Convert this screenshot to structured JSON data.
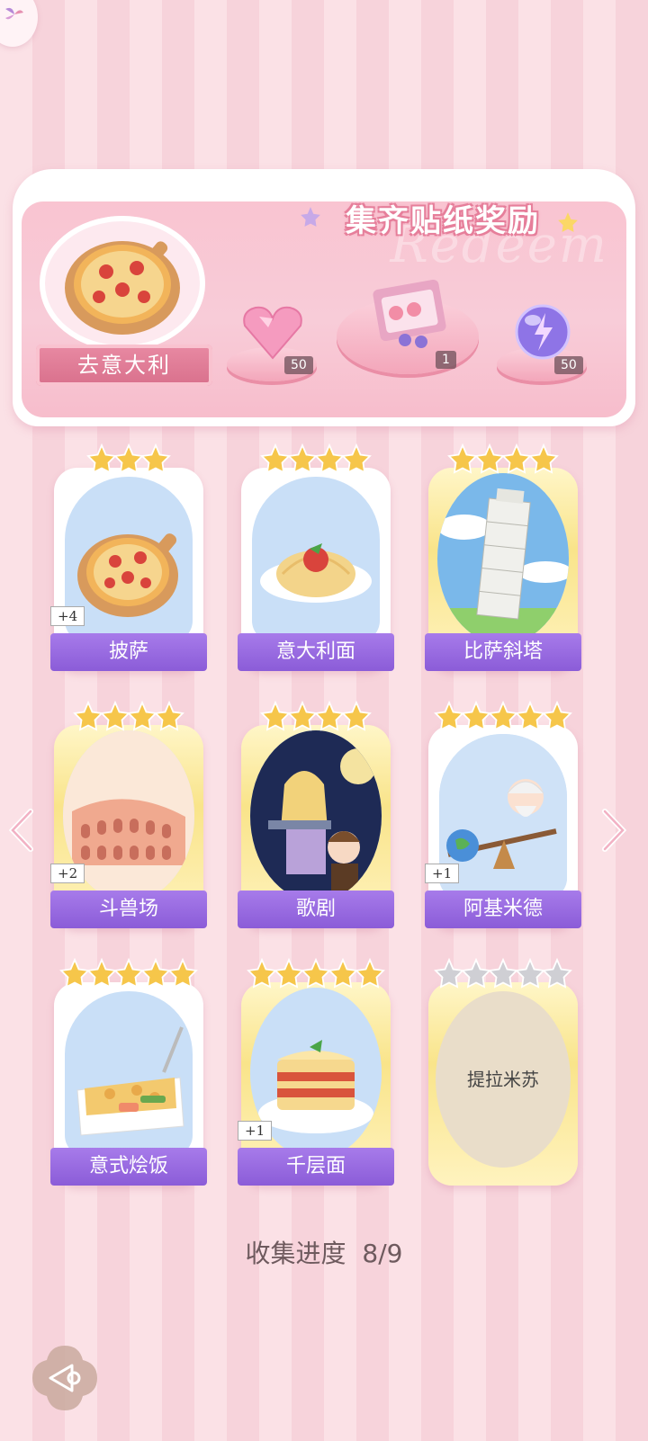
{
  "header": {
    "menu_icon": "fan-menu-icon"
  },
  "reward": {
    "title": "集齐贴纸奖励",
    "watermark": "Redeem",
    "region": "去意大利",
    "items": [
      {
        "icon": "pink-heart-gem-icon",
        "count": "50"
      },
      {
        "icon": "gift-box-icon",
        "count": "1"
      },
      {
        "icon": "purple-energy-orb-icon",
        "count": "50"
      }
    ]
  },
  "cards": [
    {
      "name": "披萨",
      "stars": 3,
      "max_stars": 3,
      "bonus": "+4",
      "gold": false,
      "collected": true
    },
    {
      "name": "意大利面",
      "stars": 4,
      "max_stars": 4,
      "bonus": "",
      "gold": false,
      "collected": true
    },
    {
      "name": "比萨斜塔",
      "stars": 4,
      "max_stars": 4,
      "bonus": "",
      "gold": true,
      "collected": true
    },
    {
      "name": "斗兽场",
      "stars": 4,
      "max_stars": 4,
      "bonus": "+2",
      "gold": true,
      "collected": true
    },
    {
      "name": "歌剧",
      "stars": 4,
      "max_stars": 4,
      "bonus": "",
      "gold": true,
      "collected": true
    },
    {
      "name": "阿基米德",
      "stars": 5,
      "max_stars": 5,
      "bonus": "+1",
      "gold": false,
      "collected": true
    },
    {
      "name": "意式烩饭",
      "stars": 5,
      "max_stars": 5,
      "bonus": "",
      "gold": false,
      "collected": true
    },
    {
      "name": "千层面",
      "stars": 5,
      "max_stars": 5,
      "bonus": "+1",
      "gold": true,
      "collected": true
    },
    {
      "name": "提拉米苏",
      "stars": 0,
      "max_stars": 5,
      "bonus": "",
      "gold": true,
      "collected": false
    }
  ],
  "progress": {
    "label": "收集进度",
    "value": "8/9"
  },
  "colors": {
    "accent_purple": "#8b5cd8",
    "pink": "#f7d3db",
    "gold": "#f9e48a"
  }
}
